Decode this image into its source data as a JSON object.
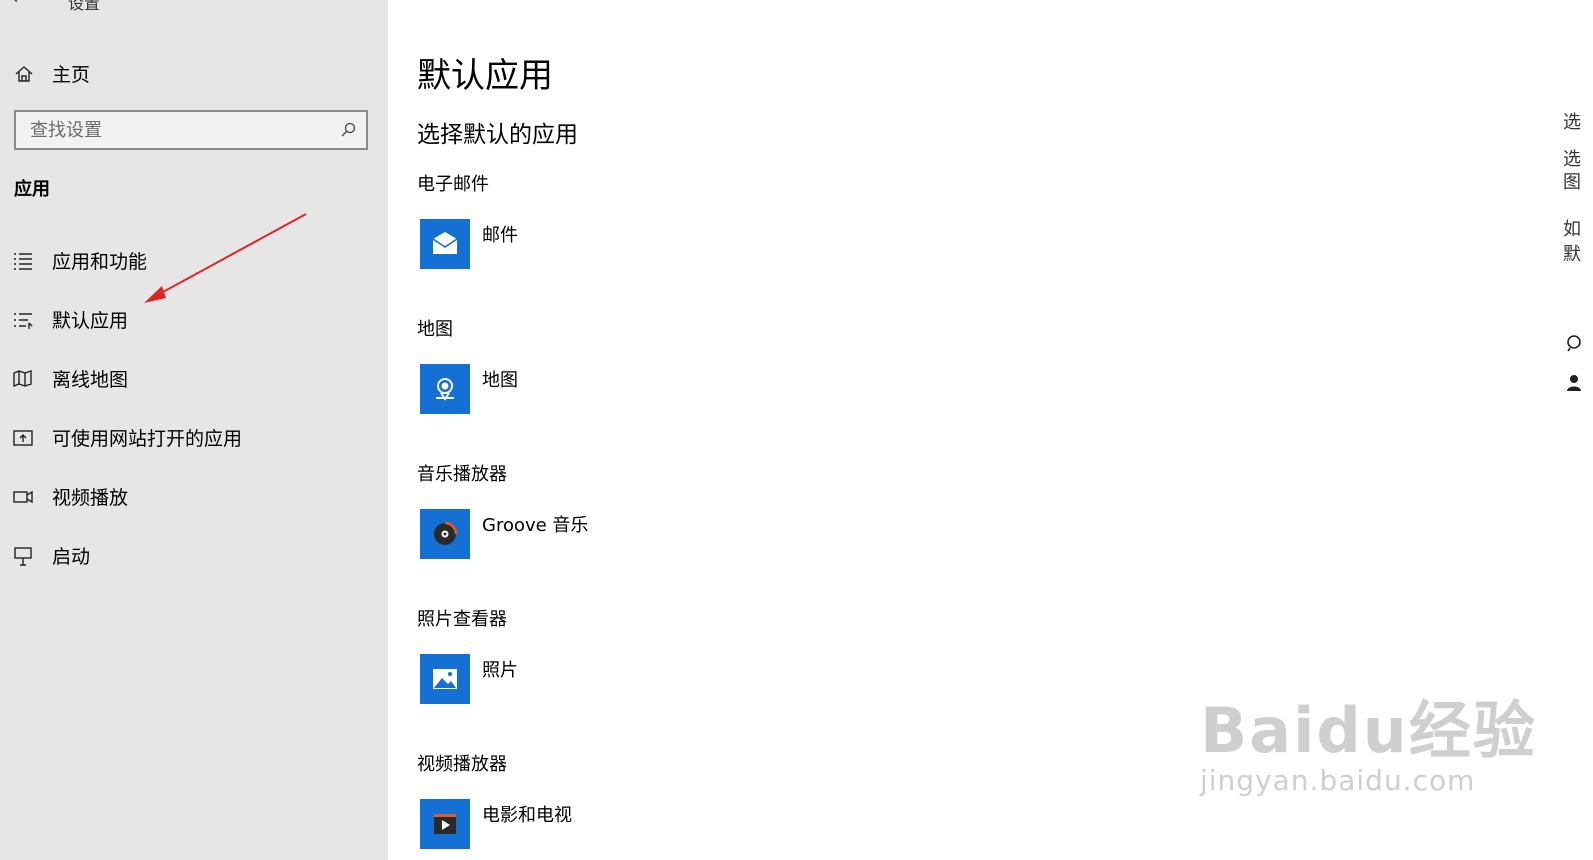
{
  "window": {
    "back_label": "←",
    "title": "设置"
  },
  "sidebar": {
    "home_label": "主页",
    "search_placeholder": "查找设置",
    "section_title": "应用",
    "items": [
      {
        "label": "应用和功能",
        "icon": "apps-features-icon"
      },
      {
        "label": "默认应用",
        "icon": "default-apps-icon"
      },
      {
        "label": "离线地图",
        "icon": "offline-maps-icon"
      },
      {
        "label": "可使用网站打开的应用",
        "icon": "apps-for-websites-icon"
      },
      {
        "label": "视频播放",
        "icon": "video-playback-icon"
      },
      {
        "label": "启动",
        "icon": "startup-icon"
      }
    ]
  },
  "main": {
    "page_title": "默认应用",
    "subtitle": "选择默认的应用",
    "categories": [
      {
        "label": "电子邮件",
        "app": "邮件",
        "icon": "mail-icon"
      },
      {
        "label": "地图",
        "app": "地图",
        "icon": "maps-icon"
      },
      {
        "label": "音乐播放器",
        "app": "Groove 音乐",
        "icon": "groove-music-icon"
      },
      {
        "label": "照片查看器",
        "app": "照片",
        "icon": "photos-icon"
      },
      {
        "label": "视频播放器",
        "app": "电影和电视",
        "icon": "movies-tv-icon"
      }
    ]
  },
  "right_panel": {
    "fragments": [
      "选",
      "选",
      "图",
      "如",
      "默"
    ]
  },
  "watermark": {
    "main": "Baidu经验",
    "sub": "jingyan.baidu.com"
  },
  "colors": {
    "sidebar_bg": "#e6e6e6",
    "accent": "#1470d3",
    "annotation_arrow": "#e02424"
  }
}
